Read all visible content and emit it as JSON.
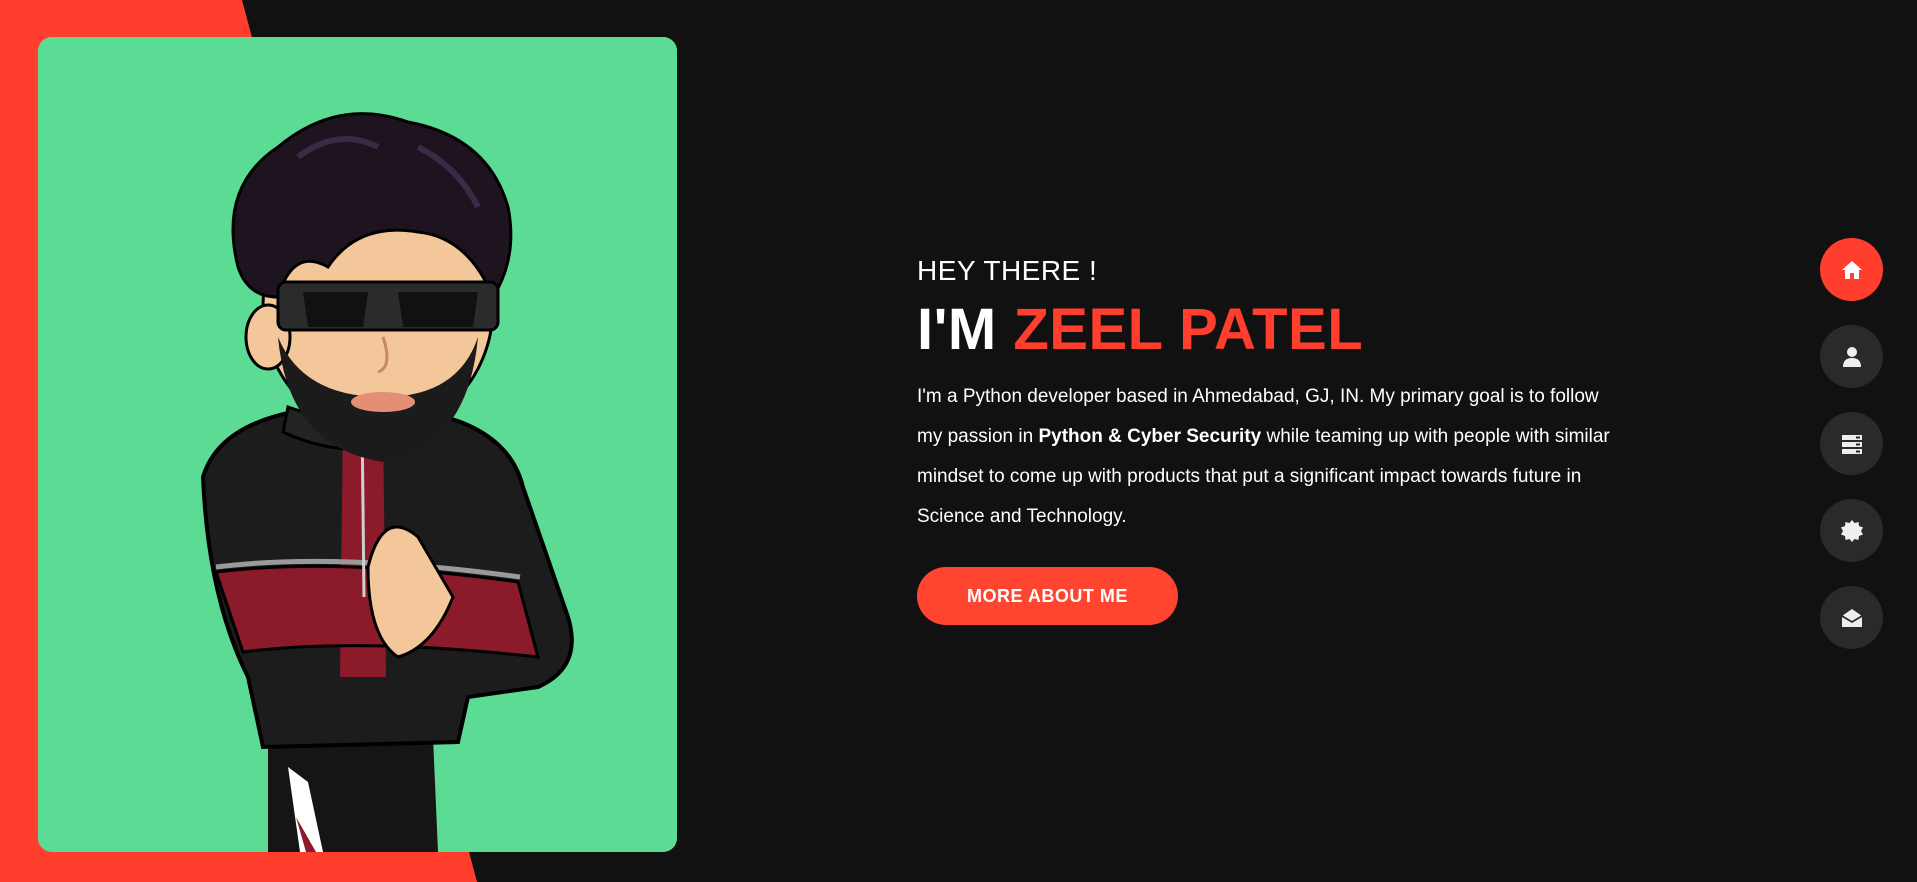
{
  "colors": {
    "accent": "#ff3e2e",
    "background": "#111111",
    "card": "#5cdb95",
    "nav_inactive": "#2a2a2a"
  },
  "hero": {
    "greeting": "HEY THERE !",
    "name_prefix": "I'M",
    "name": "ZEEL PATEL",
    "intro_part1": "I'm a Python developer based in Ahmedabad, GJ, IN. My primary goal is to follow my passion in ",
    "intro_bold": "Python & Cyber Security",
    "intro_part2": " while teaming up with people with similar mindset to come up with products that put a significant impact towards future in Science and Technology.",
    "cta_label": "MORE ABOUT ME"
  },
  "nav": {
    "items": [
      {
        "icon": "home-icon",
        "active": true
      },
      {
        "icon": "user-icon",
        "active": false
      },
      {
        "icon": "server-icon",
        "active": false
      },
      {
        "icon": "badge-icon",
        "active": false
      },
      {
        "icon": "envelope-open-icon",
        "active": false
      }
    ]
  }
}
